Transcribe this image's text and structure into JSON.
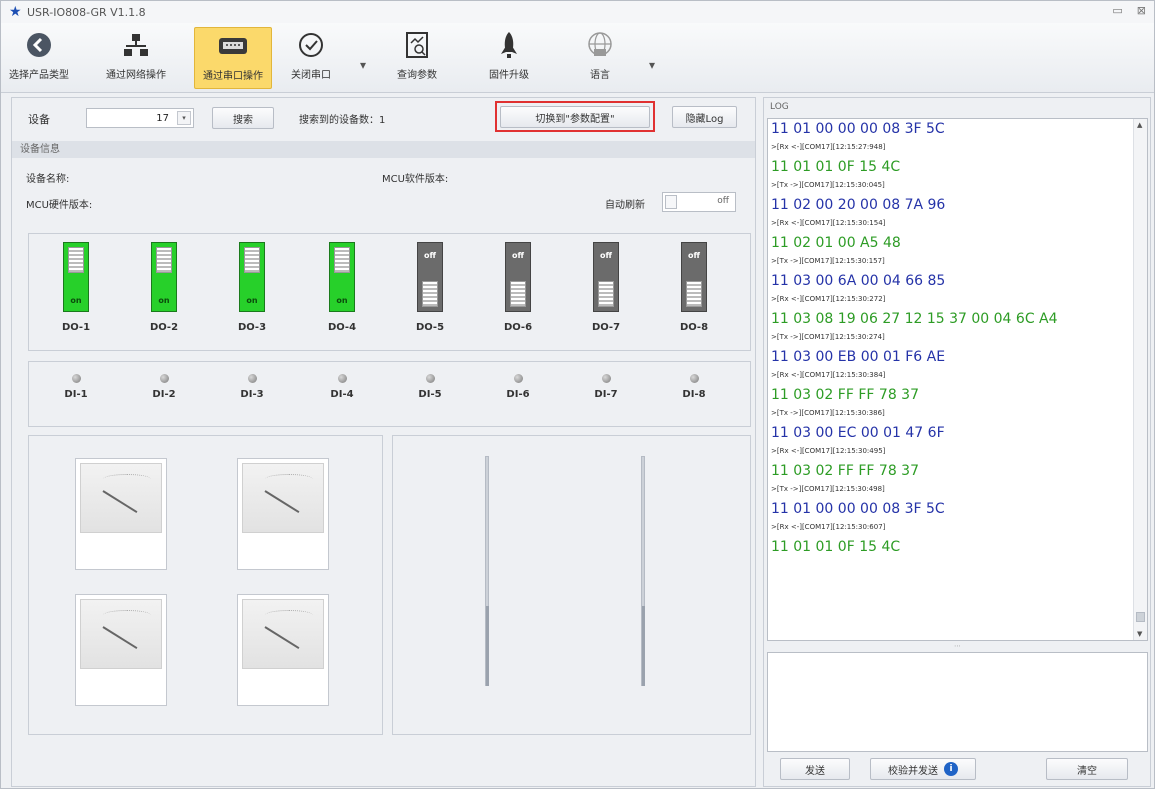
{
  "window": {
    "title": "USR-IO808-GR V1.1.8",
    "minimize": "▭",
    "close": "⊠"
  },
  "toolbar": {
    "items": [
      {
        "label": "选择产品类型",
        "icon": "back-arrow-icon"
      },
      {
        "label": "通过网络操作",
        "icon": "network-icon"
      },
      {
        "label": "通过串口操作",
        "icon": "serial-port-icon",
        "active": true
      },
      {
        "label": "关闭串口",
        "icon": "check-circle-icon"
      },
      {
        "label": "查询参数",
        "icon": "search-params-icon"
      },
      {
        "label": "固件升级",
        "icon": "rocket-icon"
      },
      {
        "label": "语言",
        "icon": "globe-icon"
      }
    ],
    "dropdown_glyph": "▾"
  },
  "device": {
    "label": "设备",
    "address": "17",
    "spin_glyph": "▾",
    "search_label": "搜索",
    "found_text": "搜索到的设备数：1",
    "switch_label": "切换到\"参数配置\"",
    "hide_log_label": "隐藏Log"
  },
  "info": {
    "section_title": "设备信息",
    "device_name": "设备名称:",
    "mcu_soft": "MCU软件版本:",
    "mcu_hard": "MCU硬件版本:",
    "auto_refresh": "自动刷新",
    "auto_refresh_state": "off"
  },
  "do": [
    {
      "label": "DO-1",
      "state": "on"
    },
    {
      "label": "DO-2",
      "state": "on"
    },
    {
      "label": "DO-3",
      "state": "on"
    },
    {
      "label": "DO-4",
      "state": "on"
    },
    {
      "label": "DO-5",
      "state": "off"
    },
    {
      "label": "DO-6",
      "state": "off"
    },
    {
      "label": "DO-7",
      "state": "off"
    },
    {
      "label": "DO-8",
      "state": "off"
    }
  ],
  "di": [
    "DI-1",
    "DI-2",
    "DI-3",
    "DI-4",
    "DI-5",
    "DI-6",
    "DI-7",
    "DI-8"
  ],
  "log": {
    "title": "LOG",
    "entries": [
      {
        "type": "rx",
        "text": "11 01 00 00 00 08 3F 5C"
      },
      {
        "type": "meta",
        "text": ">[Rx <-][COM17][12:15:27:948]"
      },
      {
        "type": "tx",
        "text": "11 01 01 0F 15 4C"
      },
      {
        "type": "meta",
        "text": ">[Tx ->][COM17][12:15:30:045]"
      },
      {
        "type": "rx",
        "text": "11 02 00 20 00 08 7A 96"
      },
      {
        "type": "meta",
        "text": ">[Rx <-][COM17][12:15:30:154]"
      },
      {
        "type": "tx",
        "text": "11 02 01 00 A5 48"
      },
      {
        "type": "meta",
        "text": ">[Tx ->][COM17][12:15:30:157]"
      },
      {
        "type": "rx",
        "text": "11 03 00 6A 00 04 66 85"
      },
      {
        "type": "meta",
        "text": ">[Rx <-][COM17][12:15:30:272]"
      },
      {
        "type": "tx",
        "text": "11 03 08 19 06 27 12 15 37 00 04 6C A4"
      },
      {
        "type": "meta",
        "text": ">[Tx ->][COM17][12:15:30:274]"
      },
      {
        "type": "rx",
        "text": "11 03 00 EB 00 01 F6 AE"
      },
      {
        "type": "meta",
        "text": ">[Rx <-][COM17][12:15:30:384]"
      },
      {
        "type": "tx",
        "text": "11 03 02 FF FF 78 37"
      },
      {
        "type": "meta",
        "text": ">[Tx ->][COM17][12:15:30:386]"
      },
      {
        "type": "rx",
        "text": "11 03 00 EC 00 01 47 6F"
      },
      {
        "type": "meta",
        "text": ">[Rx <-][COM17][12:15:30:495]"
      },
      {
        "type": "tx",
        "text": "11 03 02 FF FF 78 37"
      },
      {
        "type": "meta",
        "text": ">[Tx ->][COM17][12:15:30:498]"
      },
      {
        "type": "rx",
        "text": "11 01 00 00 00 08 3F 5C"
      },
      {
        "type": "meta",
        "text": ">[Rx <-][COM17][12:15:30:607]"
      },
      {
        "type": "tx",
        "text": "11 01 01 0F 15 4C"
      }
    ],
    "send_label": "发送",
    "checksum_send_label": "校验并发送",
    "info_glyph": "i",
    "clear_label": "清空",
    "splitter_glyph": "⋯"
  },
  "colors": {
    "rx": "#2533a8",
    "tx": "#2d9c25",
    "on": "#27d02a",
    "off": "#6b6b6b",
    "active_tab": "#fbd96b",
    "highlight": "#e03131"
  }
}
